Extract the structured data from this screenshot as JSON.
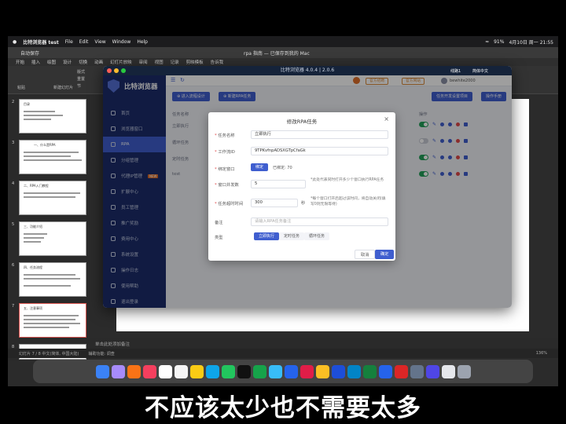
{
  "menubar": {
    "app_name": "比特浏览器 test",
    "menus": [
      "File",
      "Edit",
      "View",
      "Window",
      "Help"
    ],
    "battery": "91%",
    "datetime": "4月10日 周一  21:55"
  },
  "powerpoint": {
    "autosave": "自动保存",
    "doc_title": "rpa 指南 — 已保存到我的 Mac",
    "tabs": [
      "开始",
      "插入",
      "绘图",
      "设计",
      "切换",
      "动画",
      "幻灯片放映",
      "审阅",
      "视图",
      "记录",
      "剪映模板",
      "告诉我"
    ],
    "ribbon_labels": [
      "粘贴",
      "版式",
      "重置",
      "新建幻灯片",
      "节"
    ],
    "notes_hint": "单击此处添加备注",
    "status_left": "幻灯片 7 / 8    中文(简体, 中国大陆)",
    "status_accessibility": "辅助功能: 调查",
    "zoom": "136%",
    "thumbs": [
      {
        "num": "2",
        "title": "目录"
      },
      {
        "num": "3",
        "title": "一、什么是RPA"
      },
      {
        "num": "4",
        "title": "二、RPA入门教程"
      },
      {
        "num": "5",
        "title": "三、功能介绍"
      },
      {
        "num": "6",
        "title": "四、任务流程"
      },
      {
        "num": "7",
        "title": "五、注意事项"
      },
      {
        "num": "8",
        "title": ""
      }
    ]
  },
  "app": {
    "window_title": "比特浏览器 4.0.4 | 2.0.6",
    "logo_text": "比特浏览器",
    "nav": [
      {
        "label": "首页",
        "active": false
      },
      {
        "label": "浏览器窗口",
        "active": false
      },
      {
        "label": "RPA",
        "active": true
      },
      {
        "label": "分组管理",
        "active": false
      },
      {
        "label": "代理IP管理",
        "active": false,
        "tag": "NEW"
      },
      {
        "label": "扩展中心",
        "active": false
      },
      {
        "label": "员工管理",
        "active": false
      },
      {
        "label": "推广奖励",
        "active": false
      },
      {
        "label": "费用中心",
        "active": false
      },
      {
        "label": "系统设置",
        "active": false
      },
      {
        "label": "操作日志",
        "active": false
      },
      {
        "label": "使用帮助",
        "active": false
      },
      {
        "label": "退出登录",
        "active": false
      }
    ],
    "top_buttons": [
      "官方招聘",
      "官方网站"
    ],
    "user": "bewhite2000",
    "lang": "简体中文",
    "online": "线路1",
    "toolbar": {
      "add_flow": "进入流程设计",
      "add_task": "新建RPA任务",
      "global_settings": "任务开发设置项目",
      "docs": "操作手册"
    },
    "table": {
      "col_name": "任务名称",
      "col_ops": "操作",
      "rows": [
        {
          "name": "立即执行",
          "on": true
        },
        {
          "name": "循环任务",
          "on": false
        },
        {
          "name": "定时任务",
          "on": true
        },
        {
          "name": "test",
          "on": true
        }
      ]
    }
  },
  "modal": {
    "title": "修改RPA任务",
    "close": "×",
    "task_name_label": "任务名称",
    "task_name_value": "立即执行",
    "flow_id_label": "工作流ID",
    "flow_id_value": "9TPKvfnpADSXGTpCfaGk",
    "bind_label": "绑定窗口",
    "bind_options": [
      "绑定",
      "已绑定: 70"
    ],
    "concurrency_label": "窗口并发数",
    "concurrency_value": "5",
    "concurrency_hint": "*此处代表同时打开多少个窗口执行RPA任务",
    "timeout_label": "任务超时时间",
    "timeout_value": "300",
    "timeout_unit": "秒",
    "timeout_hint": "*每个窗口打开后超过该时间，将自动关闭(填写0则无限等待)",
    "remark_label": "备注",
    "remark_placeholder": "请输入RPA任务备注",
    "type_label": "类型",
    "types": [
      "立即执行",
      "定时任务",
      "循环任务"
    ],
    "cancel": "取消",
    "confirm": "确定"
  },
  "subtitle": "不应该太少也不需要太多"
}
